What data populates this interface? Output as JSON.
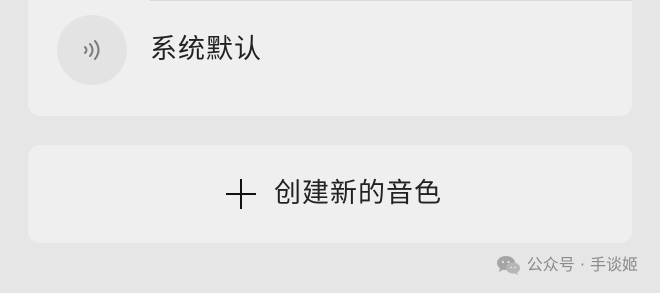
{
  "voice": {
    "label": "系统默认",
    "icon": "sound-wave-icon"
  },
  "create": {
    "label": "创建新的音色",
    "icon": "plus-icon"
  },
  "watermark": {
    "text": "公众号 · 手谈姬",
    "icon": "wechat-icon"
  }
}
